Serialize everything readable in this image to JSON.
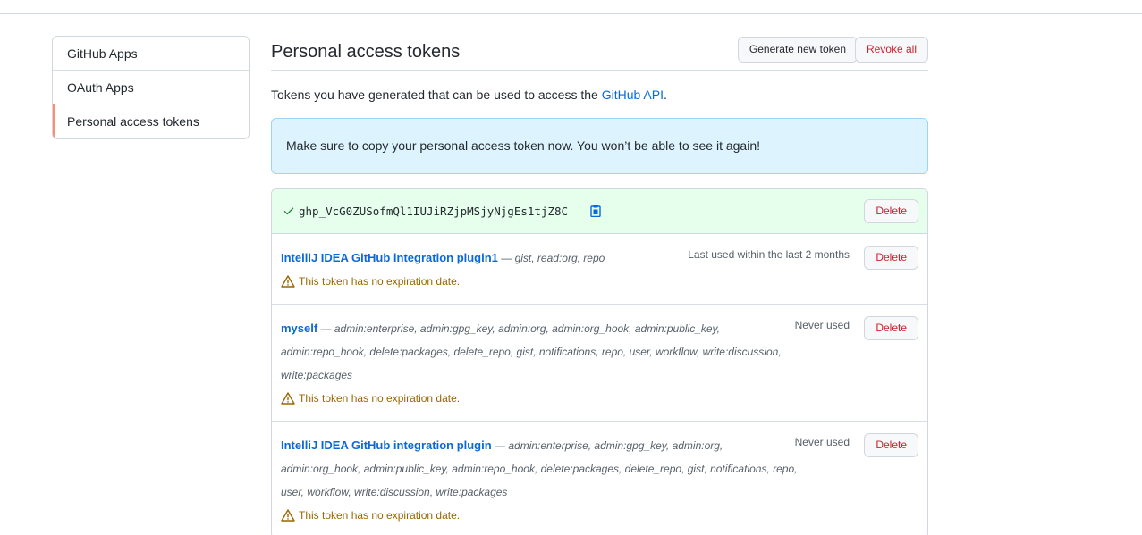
{
  "sidebar": {
    "items": [
      {
        "label": "GitHub Apps"
      },
      {
        "label": "OAuth Apps"
      },
      {
        "label": "Personal access tokens",
        "active": true
      }
    ]
  },
  "header": {
    "title": "Personal access tokens",
    "generate_label": "Generate new token",
    "revoke_label": "Revoke all"
  },
  "intro": {
    "text": "Tokens you have generated that can be used to access the ",
    "link": "GitHub API",
    "suffix": "."
  },
  "flash": {
    "message": "Make sure to copy your personal access token now. You won’t be able to see it again!"
  },
  "new_token": {
    "value": "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",
    "delete_label": "Delete"
  },
  "tokens": [
    {
      "name": "IntelliJ IDEA GitHub integration plugin1",
      "separator": " — ",
      "scopes": "gist, read:org, repo",
      "last_used": "Last used within the last 2 months",
      "warning": "This token has no expiration date.",
      "delete_label": "Delete"
    },
    {
      "name": "myself",
      "separator": " — ",
      "scopes": "admin:enterprise, admin:gpg_key, admin:org, admin:org_hook, admin:public_key, admin:repo_hook, delete:packages, delete_repo, gist, notifications, repo, user, workflow, write:discussion, write:packages",
      "last_used": "Never used",
      "warning": "This token has no expiration date.",
      "delete_label": "Delete"
    },
    {
      "name": "IntelliJ IDEA GitHub integration plugin",
      "separator": " — ",
      "scopes": "admin:enterprise, admin:gpg_key, admin:org, admin:org_hook, admin:public_key, admin:repo_hook, delete:packages, delete_repo, gist, notifications, repo, user, workflow, write:discussion, write:packages",
      "last_used": "Never used",
      "warning": "This token has no expiration date.",
      "delete_label": "Delete"
    }
  ],
  "colors": {
    "link": "#0969da",
    "danger": "#cf222e",
    "warning": "#9a6700",
    "success": "#1a7f37",
    "flash_bg": "#ddf4ff",
    "new_token_bg": "#e6ffec",
    "active_indicator": "#fd8c73"
  },
  "icons": {
    "check": "check-icon",
    "copy": "clipboard-icon",
    "warning": "alert-icon"
  }
}
